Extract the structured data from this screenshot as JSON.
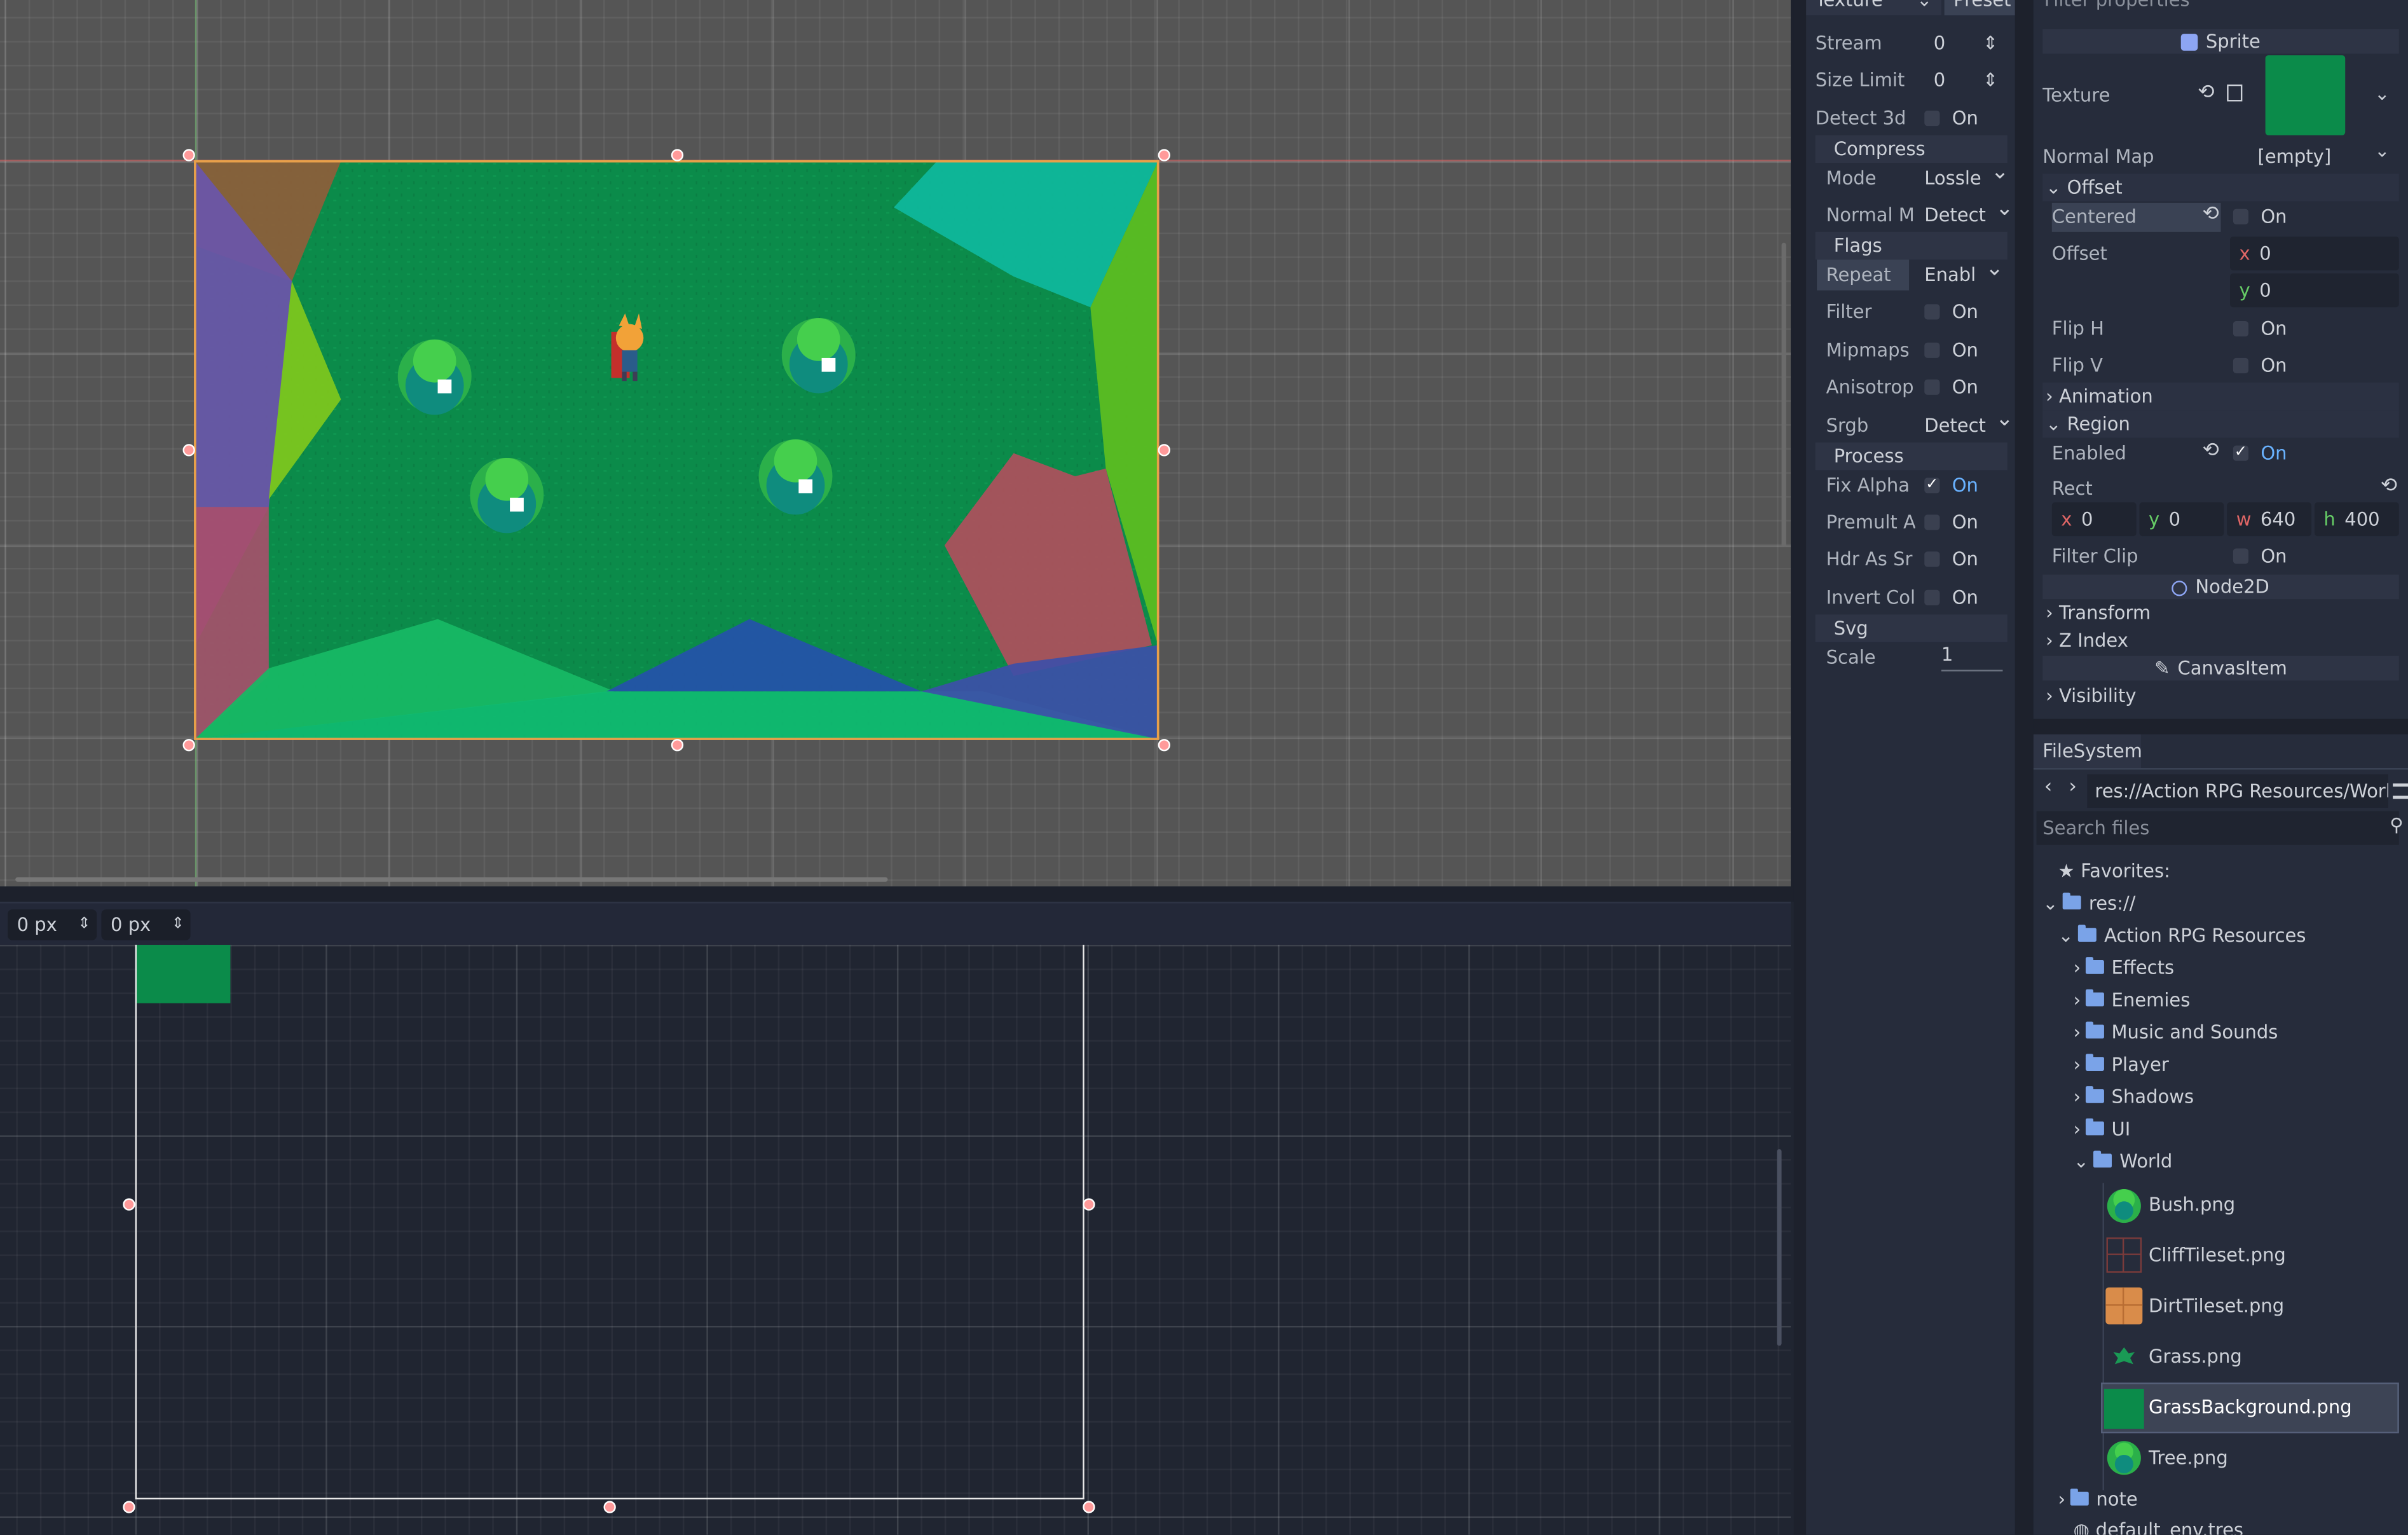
{
  "import": {
    "tab_texture": "Texture",
    "tab_preset": "Preset",
    "stream": {
      "label": "Stream",
      "value": "0"
    },
    "size_limit": {
      "label": "Size Limit",
      "value": "0"
    },
    "detect3d": {
      "label": "Detect 3d",
      "value": "On"
    },
    "compress_header": "Compress",
    "mode": {
      "label": "Mode",
      "value": "Lossle"
    },
    "normal_map": {
      "label": "Normal M",
      "value": "Detect"
    },
    "flags_header": "Flags",
    "repeat": {
      "label": "Repeat",
      "value": "Enabl"
    },
    "filter": {
      "label": "Filter",
      "value": "On"
    },
    "mipmaps": {
      "label": "Mipmaps",
      "value": "On"
    },
    "anisotropic": {
      "label": "Anisotropi",
      "value": "On"
    },
    "srgb": {
      "label": "Srgb",
      "value": "Detect"
    },
    "process_header": "Process",
    "fix_alpha": {
      "label": "Fix Alpha",
      "value": "On",
      "checked": true
    },
    "premult_alpha": {
      "label": "Premult A",
      "value": "On"
    },
    "hdr_as_srgb": {
      "label": "Hdr As Sr",
      "value": "On"
    },
    "invert_color": {
      "label": "Invert Col",
      "value": "On"
    },
    "svg_header": "Svg",
    "scale": {
      "label": "Scale",
      "value": "1"
    }
  },
  "inspector": {
    "filter_placeholder": "Filter properties",
    "sprite_header": "Sprite",
    "texture_label": "Texture",
    "normal_map_label": "Normal Map",
    "normal_map_value": "[empty]",
    "offset_group": "Offset",
    "centered_label": "Centered",
    "centered_value": "On",
    "offset_label": "Offset",
    "offset_x_axis": "x",
    "offset_x": "0",
    "offset_y_axis": "y",
    "offset_y": "0",
    "flip_h_label": "Flip H",
    "flip_h_value": "On",
    "flip_v_label": "Flip V",
    "flip_v_value": "On",
    "animation_group": "Animation",
    "region_group": "Region",
    "enabled_label": "Enabled",
    "enabled_value": "On",
    "rect_label": "Rect",
    "rect_x_axis": "x",
    "rect_x": "0",
    "rect_y_axis": "y",
    "rect_y": "0",
    "rect_w_axis": "w",
    "rect_w": "640",
    "rect_h_axis": "h",
    "rect_h": "400",
    "filter_clip_label": "Filter Clip",
    "filter_clip_value": "On",
    "node2d_header": "Node2D",
    "transform_group": "Transform",
    "zindex_group": "Z Index",
    "canvasitem_header": "CanvasItem",
    "visibility_group": "Visibility"
  },
  "filesystem": {
    "tab": "FileSystem",
    "path": "res://Action RPG Resources/World/",
    "search_placeholder": "Search files",
    "favorites": "Favorites:",
    "root": "res://",
    "project_folder": "Action RPG Resources",
    "folders": [
      "Effects",
      "Enemies",
      "Music and Sounds",
      "Player",
      "Shadows",
      "UI",
      "World"
    ],
    "files": [
      "Bush.png",
      "CliffTileset.png",
      "DirtTileset.png",
      "Grass.png",
      "GrassBackground.png",
      "Tree.png"
    ],
    "selected_file": "GrassBackground.png",
    "note_folder": "note",
    "env_file": "default_env.tres"
  },
  "region_editor": {
    "offset_x": "0 px",
    "offset_y": "0 px"
  },
  "colors": {
    "grass": "#0b8b4a",
    "accent": "#69b2ff",
    "handle": "#ff9a9a",
    "panel": "#262c3b"
  }
}
